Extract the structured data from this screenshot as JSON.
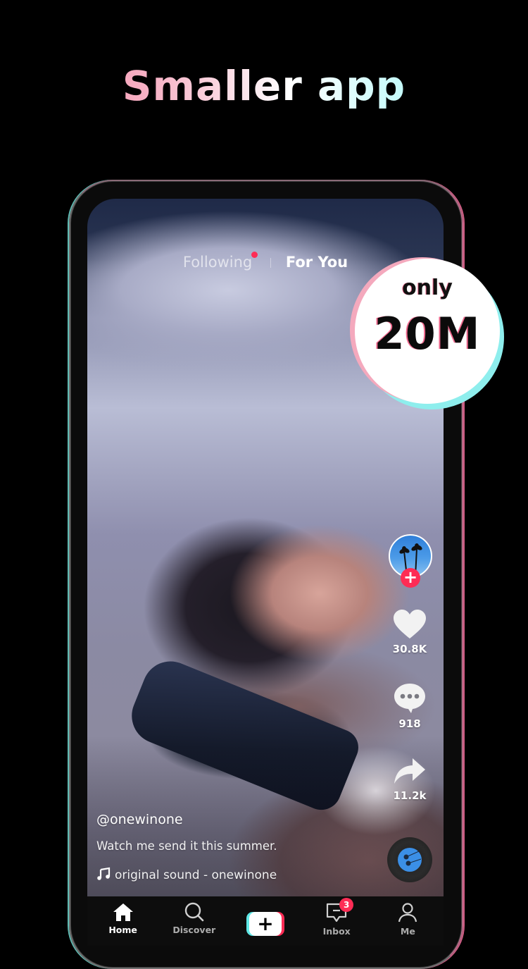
{
  "headline": "Smaller app",
  "badge": {
    "prefix": "only",
    "size": "20M"
  },
  "feed_tabs": {
    "following": "Following",
    "for_you": "For You",
    "active": "For You",
    "following_has_new": true
  },
  "video": {
    "username": "@onewinone",
    "description": "Watch me send it this summer.",
    "sound": "original sound - onewinone",
    "likes": "30.8K",
    "comments": "918",
    "shares": "11.2k"
  },
  "icons": {
    "follow": "plus-icon",
    "like": "heart-icon",
    "comment": "comment-bubble-icon",
    "share": "share-arrow-icon",
    "music": "music-note-icon",
    "disc": "spinning-disc-icon"
  },
  "nav": {
    "items": [
      {
        "label": "Home",
        "icon": "home-icon",
        "active": true
      },
      {
        "label": "Discover",
        "icon": "search-icon",
        "active": false
      },
      {
        "label": "",
        "icon": "create-plus-icon",
        "active": false
      },
      {
        "label": "Inbox",
        "icon": "inbox-icon",
        "active": false,
        "badge": "3"
      },
      {
        "label": "Me",
        "icon": "profile-icon",
        "active": false
      }
    ]
  },
  "colors": {
    "accent_red": "#fe2c55",
    "accent_cyan": "#5fe8e6",
    "gradient_pink": "#f5809f",
    "gradient_cyan": "#7ff4f2"
  }
}
